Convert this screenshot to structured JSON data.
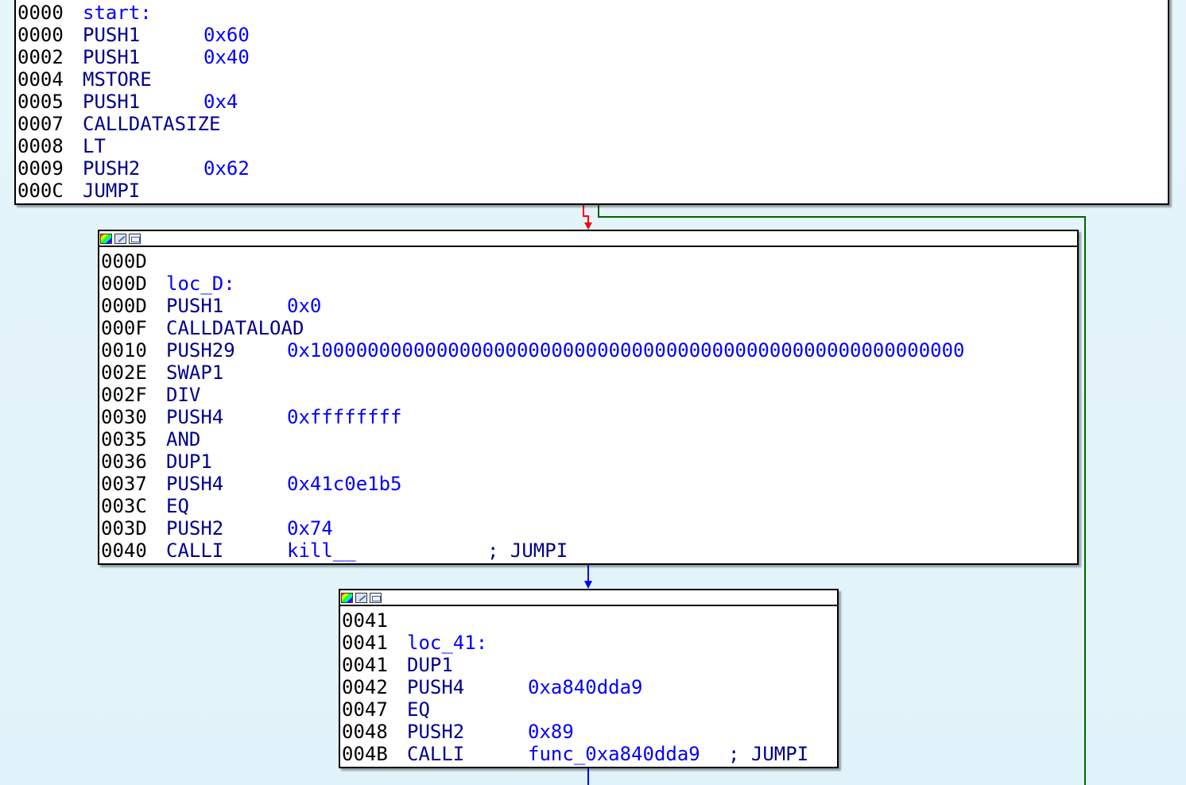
{
  "colors": {
    "edge_true": "#006400",
    "edge_false": "#ff0000",
    "edge_flow": "#0000ff",
    "address": "#000000",
    "label": "#0000ff",
    "mnemonic": "#00008b",
    "operand": "#0000ff"
  },
  "title_bar_icons": [
    "color-palette-icon",
    "edit-pencil-icon",
    "graph-view-icon"
  ],
  "blocks": {
    "start": {
      "lines": [
        {
          "addr": "0000",
          "label": "start:"
        },
        {
          "addr": "0000",
          "mnem": "PUSH1",
          "opnd": "0x60"
        },
        {
          "addr": "0002",
          "mnem": "PUSH1",
          "opnd": "0x40"
        },
        {
          "addr": "0004",
          "mnem": "MSTORE"
        },
        {
          "addr": "0005",
          "mnem": "PUSH1",
          "opnd": "0x4"
        },
        {
          "addr": "0007",
          "mnem": "CALLDATASIZE"
        },
        {
          "addr": "0008",
          "mnem": "LT"
        },
        {
          "addr": "0009",
          "mnem": "PUSH2",
          "opnd": "0x62"
        },
        {
          "addr": "000C",
          "mnem": "JUMPI"
        }
      ]
    },
    "loc_D": {
      "lines": [
        {
          "addr": "000D"
        },
        {
          "addr": "000D",
          "label": "loc_D:"
        },
        {
          "addr": "000D",
          "mnem": "PUSH1",
          "opnd": "0x0"
        },
        {
          "addr": "000F",
          "mnem": "CALLDATALOAD"
        },
        {
          "addr": "0010",
          "mnem": "PUSH29",
          "opnd": "0x100000000000000000000000000000000000000000000000000000000"
        },
        {
          "addr": "002E",
          "mnem": "SWAP1"
        },
        {
          "addr": "002F",
          "mnem": "DIV"
        },
        {
          "addr": "0030",
          "mnem": "PUSH4",
          "opnd": "0xffffffff"
        },
        {
          "addr": "0035",
          "mnem": "AND"
        },
        {
          "addr": "0036",
          "mnem": "DUP1"
        },
        {
          "addr": "0037",
          "mnem": "PUSH4",
          "opnd": "0x41c0e1b5"
        },
        {
          "addr": "003C",
          "mnem": "EQ"
        },
        {
          "addr": "003D",
          "mnem": "PUSH2",
          "opnd": "0x74"
        },
        {
          "addr": "0040",
          "mnem": "CALLI",
          "opnd": "kill__",
          "comment": "; JUMPI"
        }
      ]
    },
    "loc_41": {
      "lines": [
        {
          "addr": "0041"
        },
        {
          "addr": "0041",
          "label": "loc_41:"
        },
        {
          "addr": "0041",
          "mnem": "DUP1"
        },
        {
          "addr": "0042",
          "mnem": "PUSH4",
          "opnd": "0xa840dda9"
        },
        {
          "addr": "0047",
          "mnem": "EQ"
        },
        {
          "addr": "0048",
          "mnem": "PUSH2",
          "opnd": "0x89"
        },
        {
          "addr": "004B",
          "mnem": "CALLI",
          "opnd": "func_0xa840dda9",
          "comment": "; JUMPI"
        }
      ]
    }
  }
}
